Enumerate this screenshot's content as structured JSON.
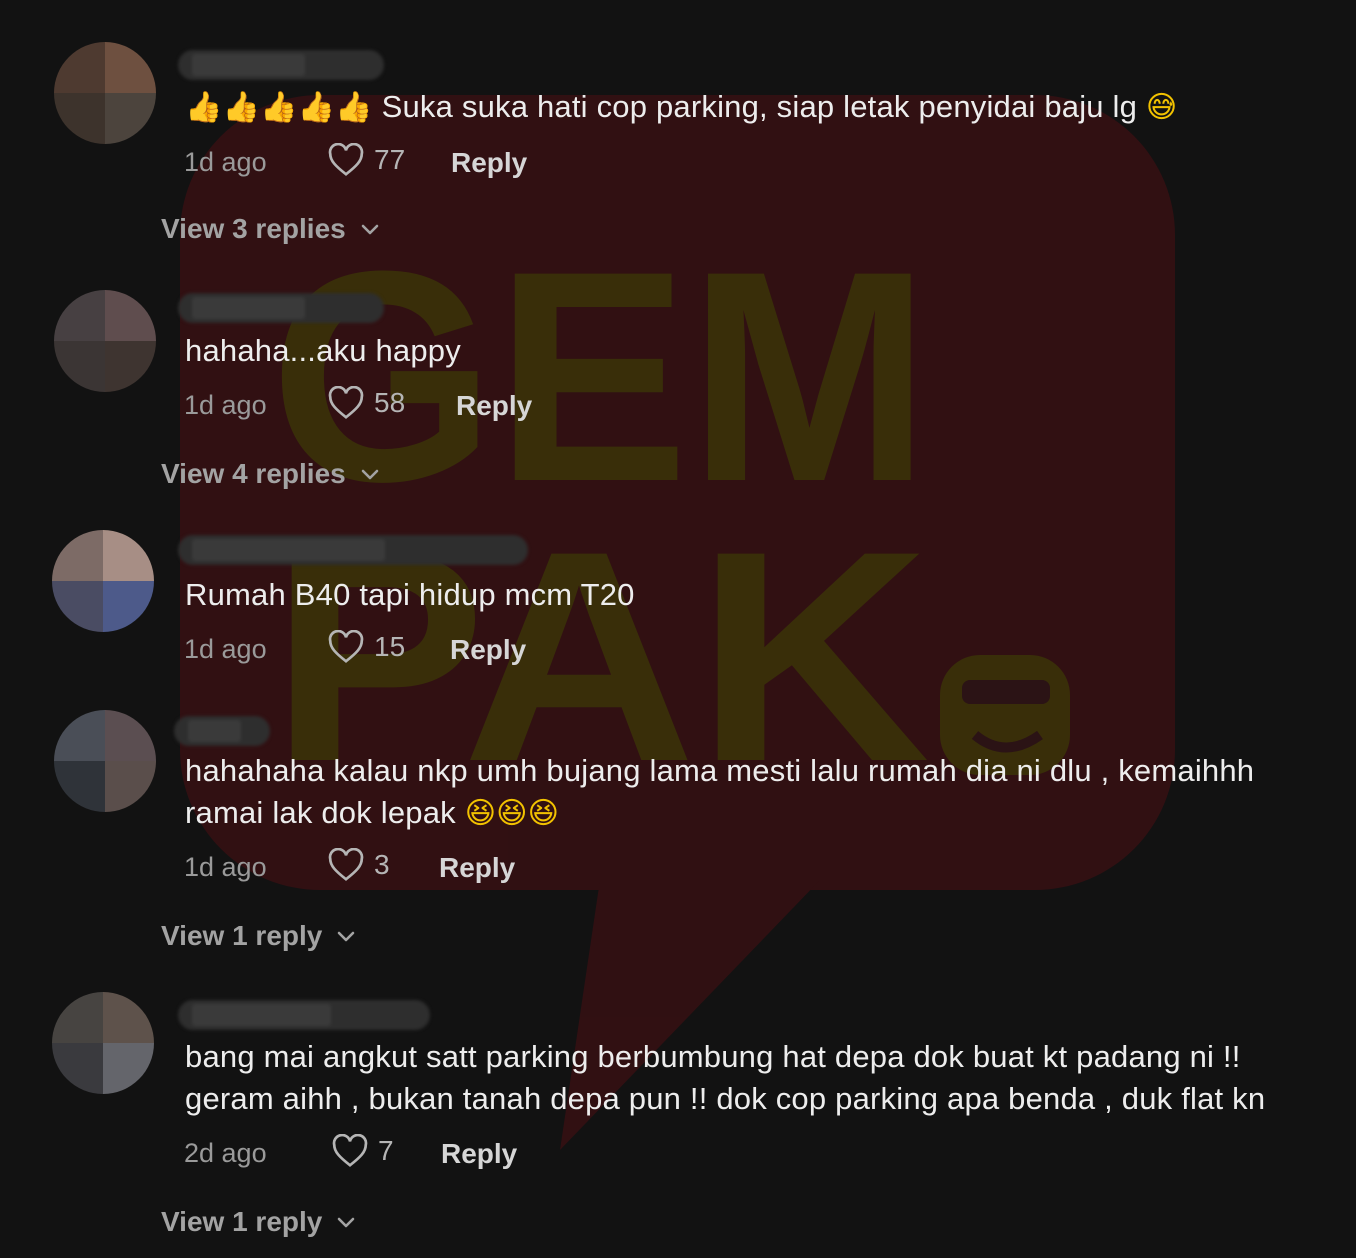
{
  "colors": {
    "background": "#121212",
    "watermark_red": "#4a0f12",
    "watermark_olive": "#3b3408",
    "text": "#ededed",
    "muted": "#9a9a9a"
  },
  "watermark": {
    "line1": "GEM",
    "line2": "PAK"
  },
  "comments": [
    {
      "text": "Suka suka hati cop parking, siap letak penyidai baju lg",
      "lead_emoji": "👍👍👍👍👍",
      "trail_emoji": "😅",
      "time": "1d ago",
      "likes": "77",
      "reply_label": "Reply",
      "view_replies": "View 3 replies"
    },
    {
      "text": "hahaha...aku happy",
      "time": "1d ago",
      "likes": "58",
      "reply_label": "Reply",
      "view_replies": "View 4 replies"
    },
    {
      "text": "Rumah B40 tapi hidup mcm T20",
      "time": "1d ago",
      "likes": "15",
      "reply_label": "Reply"
    },
    {
      "text_line1": "hahahaha kalau nkp umh bujang lama mesti lalu rumah dia ni dlu , kemaihhh",
      "text_line2": "ramai lak dok lepak",
      "trail_emoji": "😆😆😆",
      "time": "1d ago",
      "likes": "3",
      "reply_label": "Reply",
      "view_replies": "View 1 reply"
    },
    {
      "text_line1": "bang mai angkut satt parking berbumbung hat depa dok buat kt padang ni !!",
      "text_line2": "geram aihh , bukan tanah depa pun !! dok cop parking apa benda , duk flat kn",
      "time": "2d ago",
      "likes": "7",
      "reply_label": "Reply",
      "view_replies": "View 1 reply"
    }
  ]
}
